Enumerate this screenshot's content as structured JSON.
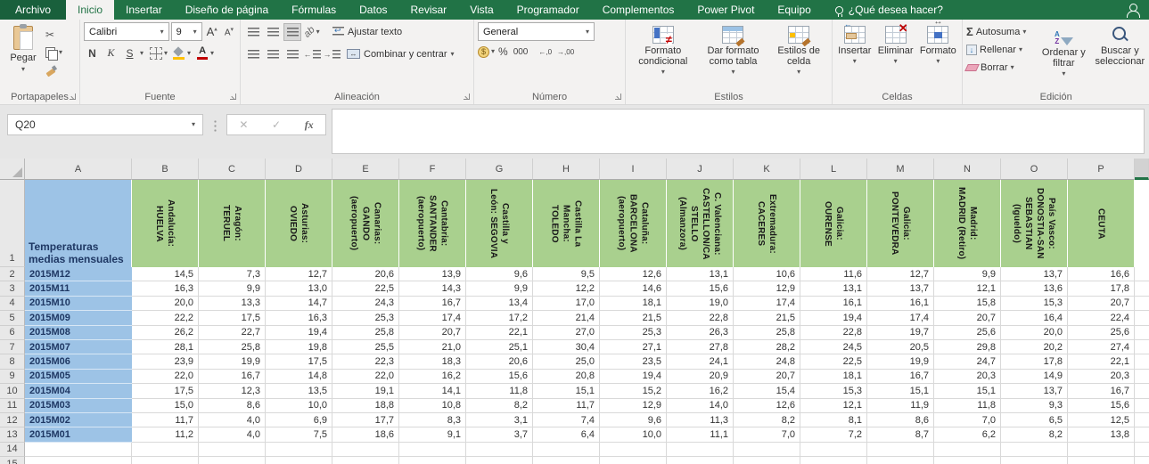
{
  "tabs": {
    "file": "Archivo",
    "selected": "Inicio",
    "items": [
      "Inicio",
      "Insertar",
      "Diseño de página",
      "Fórmulas",
      "Datos",
      "Revisar",
      "Vista",
      "Programador",
      "Complementos",
      "Power Pivot",
      "Equipo"
    ],
    "search_hint": "¿Qué desea hacer?"
  },
  "icons": {
    "dropdown": "▾",
    "scissors": "✂",
    "sum": "Σ",
    "close": "✕",
    "check": "✓",
    "fx": "fx",
    "bigger_a": "A",
    "smaller_a": "A",
    "caret_up": "▴",
    "caret_down": "▾",
    "indent_left": "←",
    "indent_right": "→",
    "orientation": "ab",
    "currency": "$",
    "percent": "%",
    "thousands": "000",
    "inc_decimal": "←,0",
    "dec_decimal": "→,00",
    "merge_arrows": "↔",
    "fill_down_arrow": "↓"
  },
  "ribbon": {
    "clipboard": {
      "paste": "Pegar",
      "label": "Portapapeles"
    },
    "font": {
      "family": "Calibri",
      "size": "9",
      "bold": "N",
      "italic": "K",
      "underline": "S",
      "label": "Fuente"
    },
    "alignment": {
      "wrap_text": "Ajustar texto",
      "merge_center": "Combinar y centrar",
      "label": "Alineación"
    },
    "number": {
      "format": "General",
      "label": "Número"
    },
    "styles": {
      "conditional": "Formato condicional",
      "format_table": "Dar formato como tabla",
      "cell_styles": "Estilos de celda",
      "label": "Estilos"
    },
    "cells": {
      "insert": "Insertar",
      "delete": "Eliminar",
      "format": "Formato",
      "label": "Celdas"
    },
    "editing": {
      "autosum": "Autosuma",
      "fill": "Rellenar",
      "clear": "Borrar",
      "sort": "Ordenar y filtrar",
      "find": "Buscar y seleccionar",
      "label": "Edición"
    }
  },
  "formula_bar": {
    "name_box": "Q20",
    "formula": ""
  },
  "colors": {
    "accent_green": "#217346",
    "header_fill": "#A9D08E",
    "label_fill": "#9DC3E6",
    "label_text": "#1F3864"
  },
  "grid": {
    "column_letters": [
      "A",
      "B",
      "C",
      "D",
      "E",
      "F",
      "G",
      "H",
      "I",
      "J",
      "K",
      "L",
      "M",
      "N",
      "O",
      "P"
    ],
    "a1": "Temperaturas\nmedias mensuales",
    "headers": [
      "Andalucía:\nHUELVA",
      "Aragón:\nTERUEL",
      "Asturias:\nOVIEDO",
      "Canarias:\nGANDO\n(aeropuerto)",
      "Cantabria:\nSANTANDER\n(aeropuerto)",
      "Castilla y\nLeón: SEGOVIA",
      "Castilla La\nMancha:\nTOLEDO",
      "Cataluña:\nBARCELONA\n(aeropuerto)",
      "C. Valenciana:\nCASTELLON/CA\nSTELLO\n(Almanzora)",
      "Extremadura:\nCACERES",
      "Galicia:\nOURENSE",
      "Galicia:\nPONTEVEDRA",
      "Madrid:\nMADRID (Retiro)",
      "País Vasco:\nDONOSTIA-SAN\nSEBASTIAN\n(Igueldo)",
      "CEUTA"
    ],
    "row_labels": [
      "2015M12",
      "2015M11",
      "2015M10",
      "2015M09",
      "2015M08",
      "2015M07",
      "2015M06",
      "2015M05",
      "2015M04",
      "2015M03",
      "2015M02",
      "2015M01"
    ],
    "data": [
      [
        "14,5",
        "7,3",
        "12,7",
        "20,6",
        "13,9",
        "9,6",
        "9,5",
        "12,6",
        "13,1",
        "10,6",
        "11,6",
        "12,7",
        "9,9",
        "13,7",
        "16,6"
      ],
      [
        "16,3",
        "9,9",
        "13,0",
        "22,5",
        "14,3",
        "9,9",
        "12,2",
        "14,6",
        "15,6",
        "12,9",
        "13,1",
        "13,7",
        "12,1",
        "13,6",
        "17,8"
      ],
      [
        "20,0",
        "13,3",
        "14,7",
        "24,3",
        "16,7",
        "13,4",
        "17,0",
        "18,1",
        "19,0",
        "17,4",
        "16,1",
        "16,1",
        "15,8",
        "15,3",
        "20,7"
      ],
      [
        "22,2",
        "17,5",
        "16,3",
        "25,3",
        "17,4",
        "17,2",
        "21,4",
        "21,5",
        "22,8",
        "21,5",
        "19,4",
        "17,4",
        "20,7",
        "16,4",
        "22,4"
      ],
      [
        "26,2",
        "22,7",
        "19,4",
        "25,8",
        "20,7",
        "22,1",
        "27,0",
        "25,3",
        "26,3",
        "25,8",
        "22,8",
        "19,7",
        "25,6",
        "20,0",
        "25,6"
      ],
      [
        "28,1",
        "25,8",
        "19,8",
        "25,5",
        "21,0",
        "25,1",
        "30,4",
        "27,1",
        "27,8",
        "28,2",
        "24,5",
        "20,5",
        "29,8",
        "20,2",
        "27,4"
      ],
      [
        "23,9",
        "19,9",
        "17,5",
        "22,3",
        "18,3",
        "20,6",
        "25,0",
        "23,5",
        "24,1",
        "24,8",
        "22,5",
        "19,9",
        "24,7",
        "17,8",
        "22,1"
      ],
      [
        "22,0",
        "16,7",
        "14,8",
        "22,0",
        "16,2",
        "15,6",
        "20,8",
        "19,4",
        "20,9",
        "20,7",
        "18,1",
        "16,7",
        "20,3",
        "14,9",
        "20,3"
      ],
      [
        "17,5",
        "12,3",
        "13,5",
        "19,1",
        "14,1",
        "11,8",
        "15,1",
        "15,2",
        "16,2",
        "15,4",
        "15,3",
        "15,1",
        "15,1",
        "13,7",
        "16,7"
      ],
      [
        "15,0",
        "8,6",
        "10,0",
        "18,8",
        "10,8",
        "8,2",
        "11,7",
        "12,9",
        "14,0",
        "12,6",
        "12,1",
        "11,9",
        "11,8",
        "9,3",
        "15,6"
      ],
      [
        "11,7",
        "4,0",
        "6,9",
        "17,7",
        "8,3",
        "3,1",
        "7,4",
        "9,6",
        "11,3",
        "8,2",
        "8,1",
        "8,6",
        "7,0",
        "6,5",
        "12,5"
      ],
      [
        "11,2",
        "4,0",
        "7,5",
        "18,6",
        "9,1",
        "3,7",
        "6,4",
        "10,0",
        "11,1",
        "7,0",
        "7,2",
        "8,7",
        "6,2",
        "8,2",
        "13,8"
      ]
    ],
    "trailing_empty_rows": 2
  }
}
